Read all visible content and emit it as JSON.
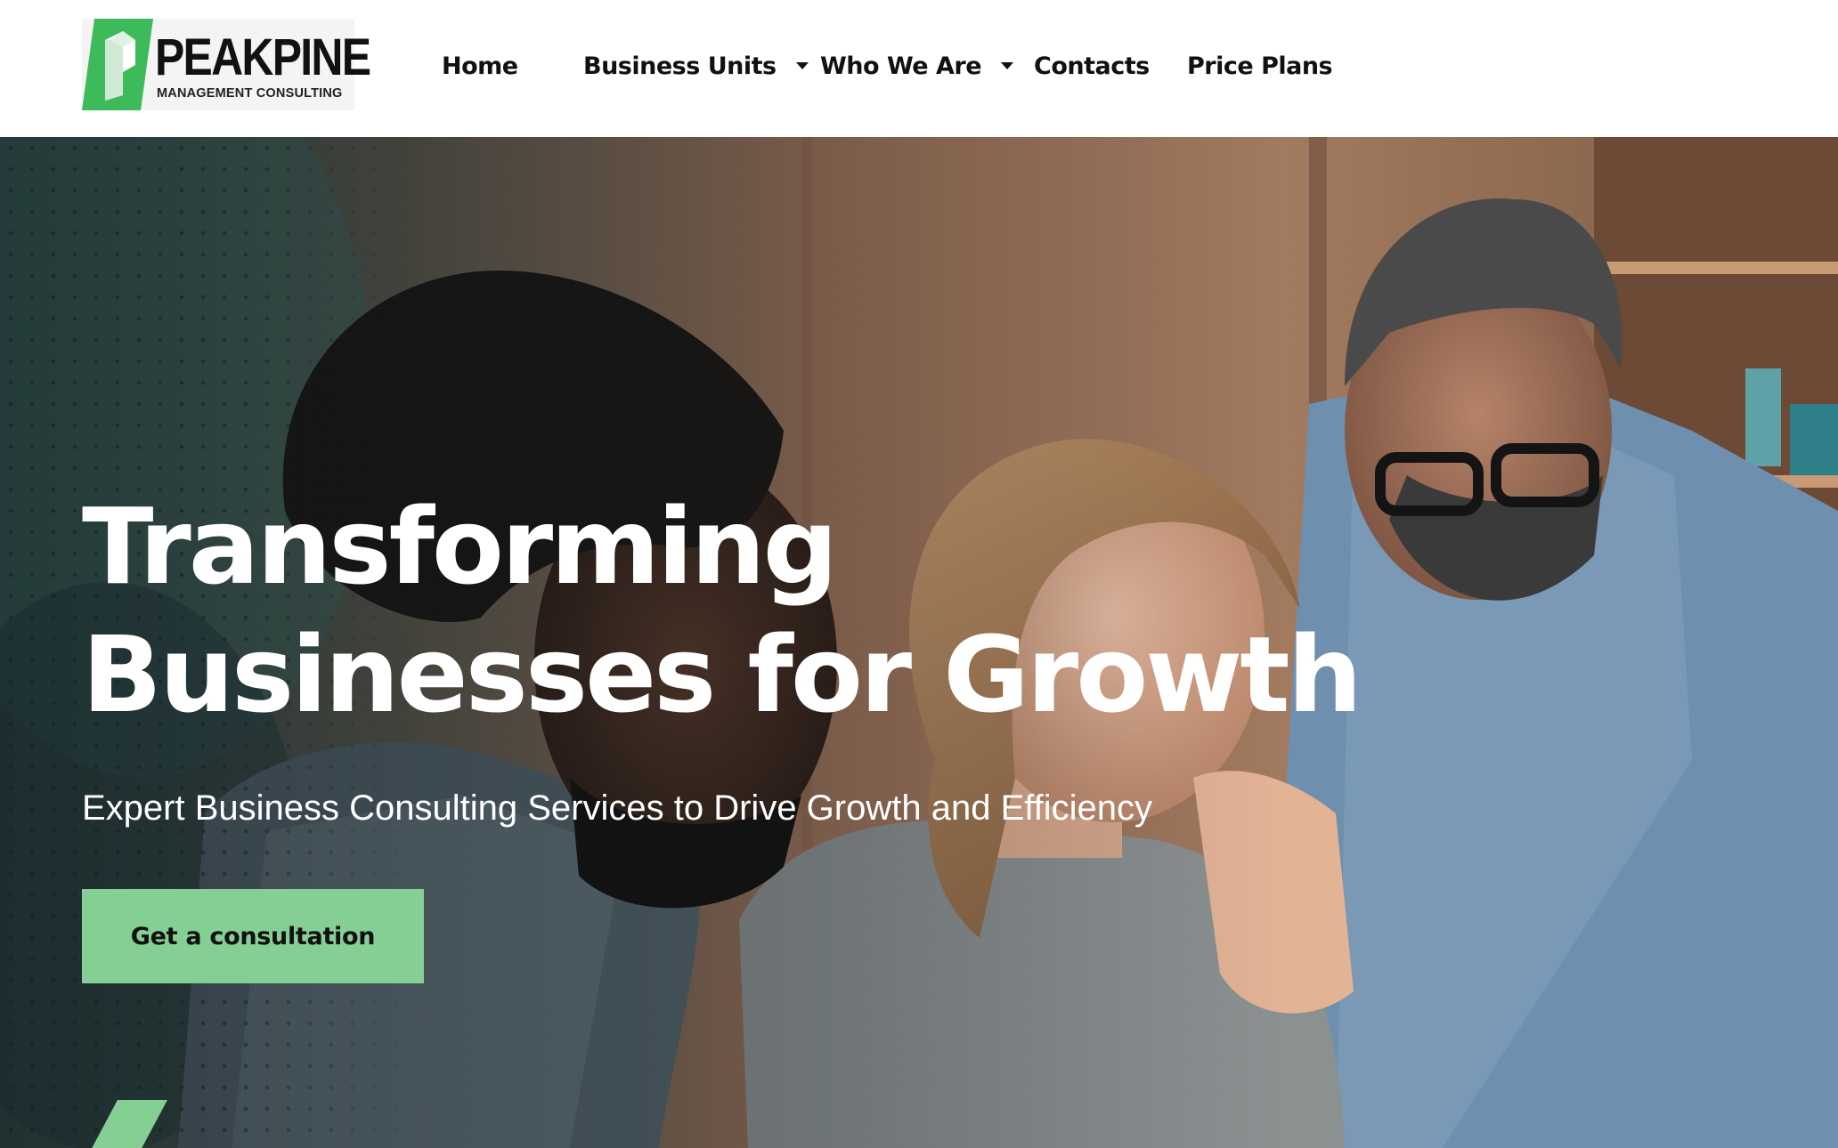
{
  "brand": {
    "name": "PEAKPINE",
    "tagline": "MANAGEMENT CONSULTING",
    "logo_icon": "peakpine-logo-icon",
    "accent_color": "#86cf94",
    "logo_green": "#3dbb5a"
  },
  "nav": {
    "items": [
      {
        "label": "Home",
        "has_dropdown": false
      },
      {
        "label": "Business Units",
        "has_dropdown": true
      },
      {
        "label": "Who We Are",
        "has_dropdown": true
      },
      {
        "label": "Contacts",
        "has_dropdown": false
      },
      {
        "label": "Price Plans",
        "has_dropdown": false
      }
    ]
  },
  "hero": {
    "title_line1": "Transforming",
    "title_line2": "Businesses for Growth",
    "subtitle": "Expert Business Consulting Services to Drive Growth and Efficiency",
    "cta_label": "Get a consultation",
    "background": "photo of three colleagues looking at a screen in an office"
  }
}
